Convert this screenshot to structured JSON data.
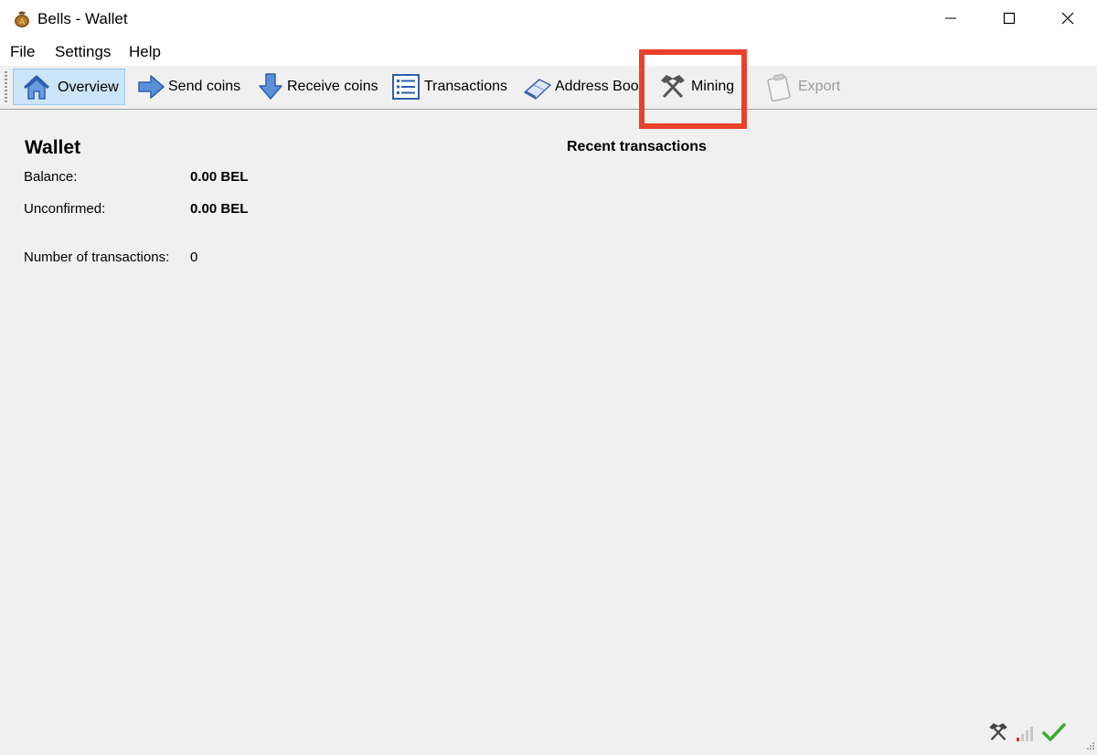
{
  "window": {
    "title": "Bells - Wallet",
    "icon": "bells-app-icon",
    "controls": [
      "minimize-icon",
      "maximize-icon",
      "close-icon"
    ]
  },
  "menu": [
    "File",
    "Settings",
    "Help"
  ],
  "toolbar": {
    "overview": {
      "label": "Overview",
      "icon": "home-icon",
      "active": true
    },
    "send": {
      "label": "Send coins",
      "icon": "arrow-right-icon"
    },
    "receive": {
      "label": "Receive coins",
      "icon": "arrow-down-icon"
    },
    "transactions": {
      "label": "Transactions",
      "icon": "list-icon"
    },
    "address_book": {
      "label": "Address Book",
      "icon": "address-book-icon"
    },
    "mining": {
      "label": "Mining",
      "icon": "hammers-icon"
    },
    "export": {
      "label": "Export",
      "icon": "clipboard-icon",
      "enabled": false
    }
  },
  "highlight": {
    "target": "Mining",
    "color": "#e8412c"
  },
  "wallet": {
    "title": "Wallet",
    "balance_label": "Balance:",
    "balance_value": "0.00 BEL",
    "unconfirmed_label": "Unconfirmed:",
    "unconfirmed_value": "0.00 BEL",
    "tx_count_label": "Number of transactions:",
    "tx_count_value": "0"
  },
  "recent": {
    "title": "Recent transactions"
  },
  "statusbar": {
    "icons": [
      "mining-status-icon",
      "connection-signal-icon",
      "synced-check-icon"
    ]
  },
  "colors": {
    "accent_active": "#cce4f7",
    "highlight": "#e8412c",
    "check": "#3aaa35"
  }
}
